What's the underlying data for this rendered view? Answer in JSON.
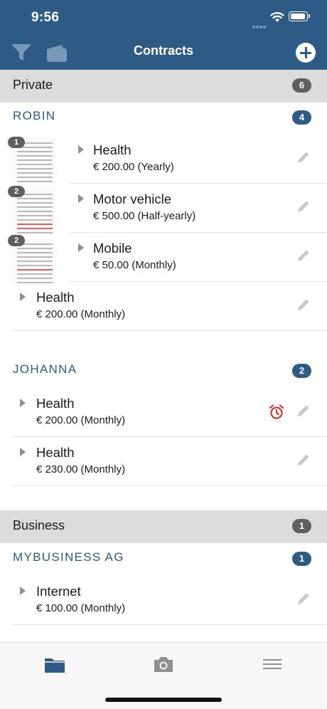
{
  "status": {
    "time": "9:56"
  },
  "nav": {
    "title": "Contracts",
    "icons": [
      "filter-icon",
      "card-icon",
      "add-icon"
    ]
  },
  "sections": [
    {
      "label": "Private",
      "count": "6",
      "persons": [
        {
          "name": "ROBIN",
          "count": "4",
          "contracts": [
            {
              "title": "Health",
              "amount": "€ 200.00 (Yearly)",
              "doc_count": "1"
            },
            {
              "title": "Motor vehicle",
              "amount": "€ 500.00 (Half-yearly)",
              "doc_count": "2"
            },
            {
              "title": "Mobile",
              "amount": "€ 50.00 (Monthly)",
              "doc_count": "2"
            },
            {
              "title": "Health",
              "amount": "€ 200.00 (Monthly)"
            }
          ]
        },
        {
          "name": "JOHANNA",
          "count": "2",
          "contracts": [
            {
              "title": "Health",
              "amount": "€ 200.00 (Monthly)",
              "reminder": true
            },
            {
              "title": "Health",
              "amount": "€ 230.00 (Monthly)"
            }
          ]
        }
      ]
    },
    {
      "label": "Business",
      "count": "1",
      "persons": [
        {
          "name": "MYBUSINESS AG",
          "count": "1",
          "contracts": [
            {
              "title": "Internet",
              "amount": "€ 100.00 (Monthly)"
            }
          ]
        }
      ]
    }
  ],
  "tabbar": {
    "tabs": [
      "folder-icon",
      "camera-icon",
      "menu-icon"
    ],
    "active": "folder-icon"
  },
  "colors": {
    "brand": "#2e5a86",
    "alarm": "#e02020",
    "badge_gray": "#5f5f5f"
  }
}
